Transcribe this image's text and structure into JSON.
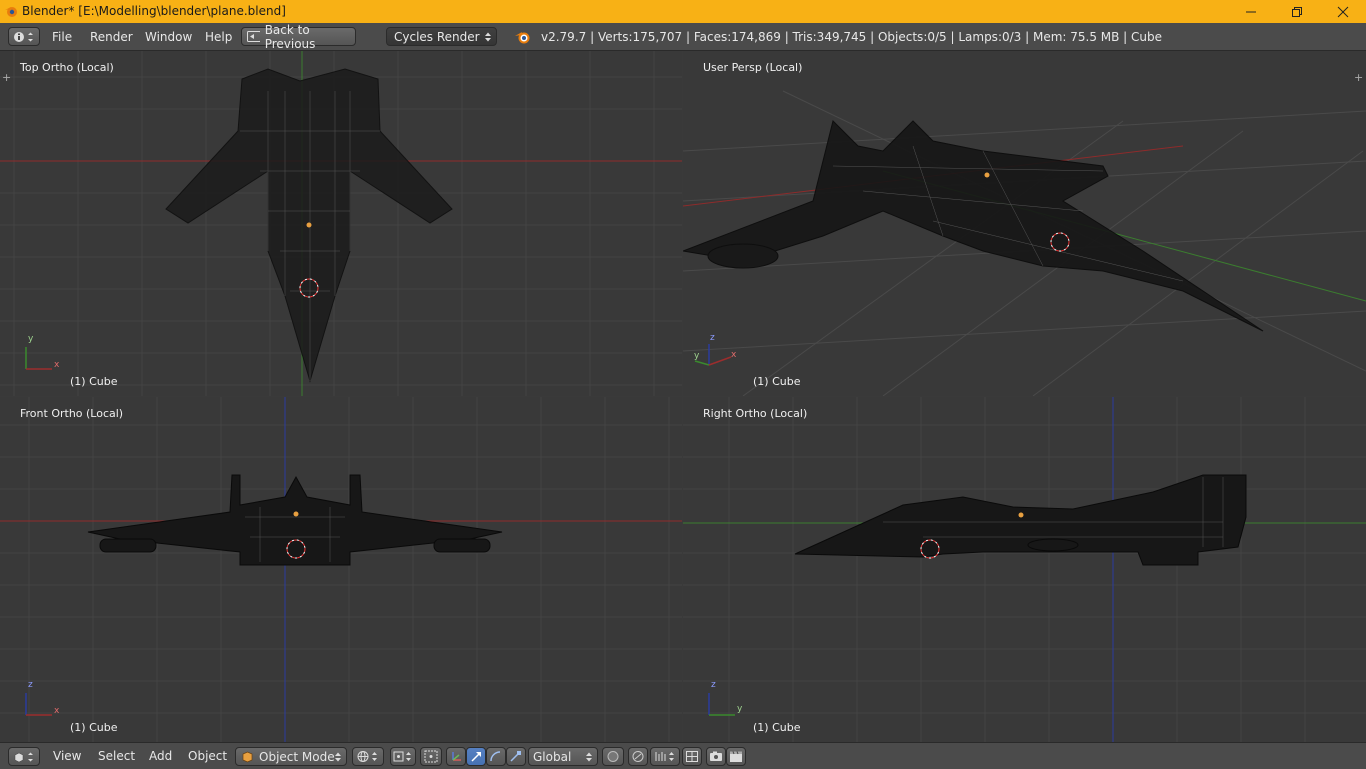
{
  "window": {
    "title": "Blender* [E:\\Modelling\\blender\\plane.blend]"
  },
  "header": {
    "menus": [
      "File",
      "Render",
      "Window",
      "Help"
    ],
    "back_button": "Back to Previous",
    "render_engine": "Cycles Render",
    "stats": "v2.79.7 | Verts:175,707 | Faces:174,869 | Tris:349,745 | Objects:0/5 | Lamps:0/3 | Mem: 75.5 MB | Cube"
  },
  "viewports": [
    {
      "label": "Top Ortho (Local)",
      "object": "(1) Cube",
      "axes": [
        "y",
        "x"
      ]
    },
    {
      "label": "User Persp (Local)",
      "object": "(1) Cube",
      "axes": [
        "z",
        "y",
        "x"
      ]
    },
    {
      "label": "Front Ortho (Local)",
      "object": "(1) Cube",
      "axes": [
        "z",
        "x"
      ]
    },
    {
      "label": "Right Ortho (Local)",
      "object": "(1) Cube",
      "axes": [
        "z",
        "y"
      ]
    }
  ],
  "bottombar": {
    "menus": [
      "View",
      "Select",
      "Add",
      "Object"
    ],
    "mode": "Object Mode",
    "orientation": "Global"
  },
  "colors": {
    "titlebar": "#f8b115",
    "viewport_bg": "#393939",
    "x_axis": "#9c2d2d",
    "y_axis": "#3a8a2e",
    "z_axis": "#2a3c9e",
    "selection": "#5680c2"
  }
}
